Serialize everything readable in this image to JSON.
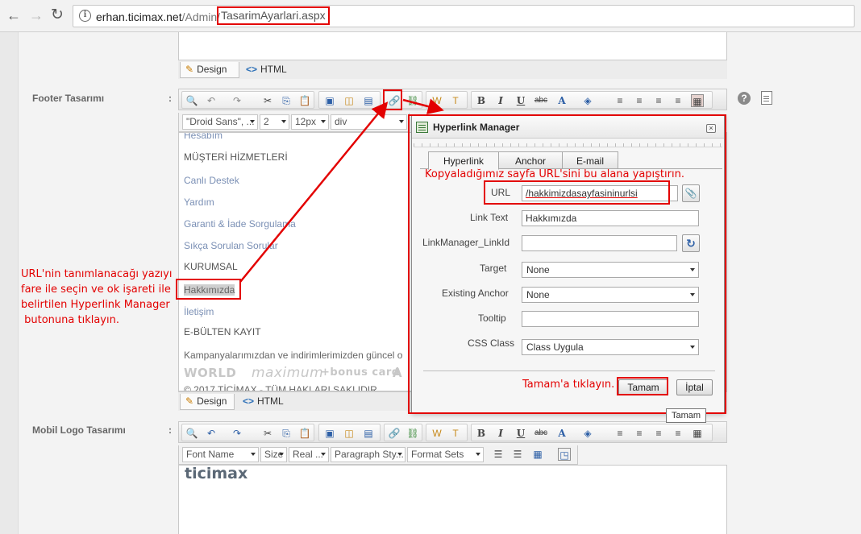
{
  "browser": {
    "back_glyph": "←",
    "forward_glyph": "→",
    "reload_glyph": "↻",
    "info_glyph": "i",
    "url_host": "erhan.ticimax.net",
    "url_path": "/Admin/",
    "url_page": "TasarimAyarlari.aspx"
  },
  "top_editor": {
    "design_tab": "Design",
    "html_tab": "HTML",
    "pencil_glyph": "✎",
    "code_glyph": "<>"
  },
  "footer": {
    "label": "Footer Tasarımı",
    "colon": ":",
    "format": {
      "font_name": "\"Droid Sans\", ...",
      "size": "2",
      "font_size": "12px",
      "block": "div"
    },
    "content": {
      "hesabim": "Hesabım",
      "musteri_hizmetleri": "MÜŞTERİ HİZMETLERİ",
      "canli_destek": "Canlı Destek",
      "yardim": "Yardım",
      "garanti": "Garanti & İade Sorgulama",
      "sss": "Sıkça Sorulan Sorular",
      "kurumsal": "KURUMSAL",
      "hakkimizda": "Hakkımızda",
      "iletisim": "İletişim",
      "ebulten": "E-BÜLTEN KAYIT",
      "kampanya": "Kampanyalarımızdan ve indirimlerimizden güncel o",
      "brand_world": "WORLD",
      "brand_maximum": "maximum",
      "brand_bonus": "+bonus card",
      "brand_extra": "A",
      "copyright": "© 2017 TİCİMAX - TÜM HAKLARI SAKLIDIR"
    },
    "design_tab": "Design",
    "html_tab": "HTML"
  },
  "mobile_logo": {
    "label": "Mobil Logo Tasarımı",
    "colon": ":",
    "format": {
      "font_name": "Font Name",
      "size": "Size",
      "real": "Real ...",
      "paragraph": "Paragraph Sty...",
      "format_sets": "Format Sets"
    },
    "logo_text": "ticimax"
  },
  "toolbar": {
    "find": "🔍",
    "undo": "↶",
    "redo": "↷",
    "cut": "✂",
    "copy": "⎘",
    "paste": "📋",
    "image": "▣",
    "flash": "◫",
    "media": "▤",
    "hyperlink": "🔗",
    "unlink": "⛓",
    "paste_word": "W",
    "paste_text": "T",
    "bold": "B",
    "italic": "I",
    "underline": "U",
    "strike": "abc",
    "fore_color": "A",
    "back_color": "◈",
    "align_left": "≡",
    "align_center": "≡",
    "align_right": "≡",
    "justify": "≡",
    "more": "▦"
  },
  "side_icons": {
    "help": "?"
  },
  "annotations": {
    "left_note": [
      "URL'nin tanımlanacağı yazıyı",
      "fare ile seçin ve ok işareti ile",
      "belirtilen Hyperlink Manager",
      " butonuna tıklayın."
    ],
    "paste_note": "Kopyaladığımız sayfa URL'sini bu alana yapıştırın.",
    "ok_note": "Tamam'a tıklayın."
  },
  "dialog": {
    "title": "Hyperlink Manager",
    "close_glyph": "×",
    "tabs": [
      "Hyperlink",
      "Anchor",
      "E-mail"
    ],
    "fields": {
      "url_label": "URL",
      "url_value": "/hakkimizdasayfasininurlsi",
      "link_text_label": "Link Text",
      "link_text_value": "Hakkımızda",
      "link_id_label": "LinkManager_LinkId",
      "link_id_value": "",
      "target_label": "Target",
      "target_value": "None",
      "anchor_label": "Existing Anchor",
      "anchor_value": "None",
      "tooltip_label": "Tooltip",
      "tooltip_value": "",
      "css_label": "CSS Class",
      "css_value": "Class Uygula"
    },
    "browse_glyph": "📎",
    "refresh_glyph": "↻",
    "ok_button": "Tamam",
    "cancel_button": "İptal",
    "tooltip_popup": "Tamam"
  },
  "colors": {
    "annotation_red": "#e30000",
    "link_blue": "#7b90b5"
  }
}
